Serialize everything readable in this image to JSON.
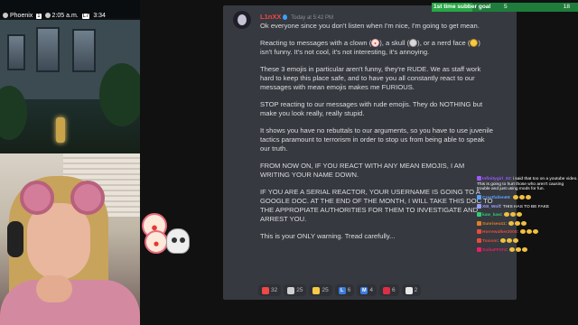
{
  "game_hud": {
    "player": "Phoenix",
    "count": "1",
    "time": "2:05 a.m.",
    "level_badge": "L7",
    "extra": "3:34"
  },
  "goal": {
    "label": "1st time subber goal",
    "current": "5",
    "target": "18",
    "progress_fraction": 0.28
  },
  "message": {
    "username": "L1nXX",
    "timestamp": "Today at 5:42 PM",
    "lines": [
      [
        "Ok everyone since you don't listen when I'm nice, I'm going to get mean."
      ],
      [
        "Reacting to messages with a clown (",
        "), a skull (",
        "), or a nerd face (",
        ")",
        "isn't funny. It's not cool, it's not interesting, it's annoying."
      ],
      [
        "These 3 emojis in particular aren't funny, they're RUDE. We as staff work",
        "hard to keep this place safe, and to have you all constantly react to our",
        "messages with mean emojis makes me FURIOUS."
      ],
      [
        "STOP reacting to our messages with rude emojis. They do NOTHING but",
        "make you look really, really stupid."
      ],
      [
        "It shows you have no rebuttals to our arguments, so you have to use juvenile",
        "tactics paramount to terrorism in order to stop us from being able to speak",
        "our truth."
      ],
      [
        "FROM NOW ON, IF YOU REACT WITH ANY MEAN EMOJIS, I AM",
        "WRITING YOUR NAME DOWN."
      ],
      [
        "IF YOU ARE A SERIAL REACTOR, YOUR USERNAME IS GOING TO A",
        "GOOGLE DOC. AT THE END OF THE MONTH, I WILL TAKE THIS DOC TO",
        "THE APPROPIATE AUTHORITIES FOR THEM TO INVESTIGATE AND",
        "ARREST YOU."
      ],
      [
        "This is your ONLY warning. Tread carefully..."
      ]
    ]
  },
  "reactions": [
    {
      "icon": "clown-icon",
      "count": "32",
      "color": "#f04747",
      "glyph": ""
    },
    {
      "icon": "skull-icon",
      "count": "25",
      "color": "#cfcfcf",
      "glyph": ""
    },
    {
      "icon": "nerd-face-icon",
      "count": "25",
      "color": "#f7c948",
      "glyph": ""
    },
    {
      "icon": "letter-l-icon",
      "count": "6",
      "color": "#3b7ddd",
      "glyph": "L"
    },
    {
      "icon": "letter-m-icon",
      "count": "4",
      "color": "#3b7ddd",
      "glyph": "M"
    },
    {
      "icon": "red-circle-icon",
      "count": "6",
      "color": "#dd2e44",
      "glyph": ""
    },
    {
      "icon": "popcorn-icon",
      "count": "2",
      "color": "#e8e8e8",
      "glyph": ""
    }
  ],
  "chat": [
    {
      "user": "Infinitygirl_92",
      "color": "#9b59ff",
      "text": "i said that too on a youtube video. This is going to hurt those who aren't causing trouble and just using mods for fun."
    },
    {
      "user": "Crestfallen69",
      "color": "#5aa0ff",
      "text": ""
    },
    {
      "user": "XIII_Wolf",
      "color": "#9aa0ff",
      "text": "THIS HAS TO BE FAKE"
    },
    {
      "user": "kaw_kaw",
      "color": "#2ecc71",
      "text": ""
    },
    {
      "user": "Sunrisex41",
      "color": "#e67e22",
      "text": ""
    },
    {
      "user": "Horrewalker2000",
      "color": "#e74c3c",
      "text": ""
    },
    {
      "user": "Toxiom",
      "color": "#e74c3c",
      "text": ""
    },
    {
      "user": "SuikaFFXIV",
      "color": "#e91e63",
      "text": ""
    }
  ]
}
